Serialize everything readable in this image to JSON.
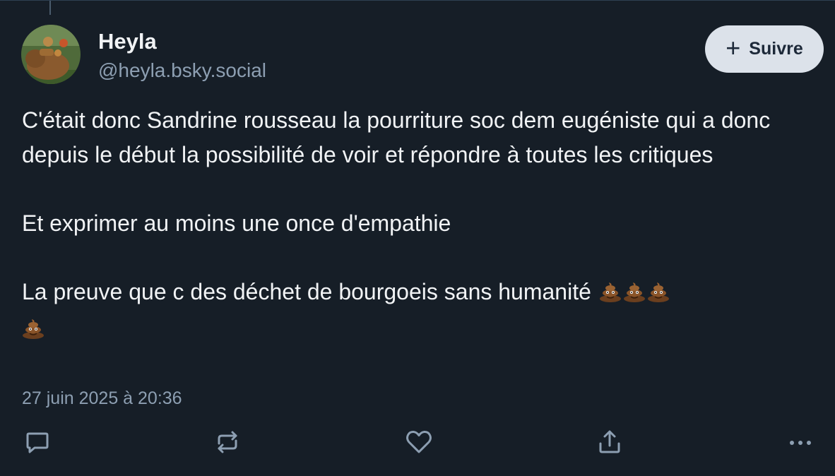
{
  "author": {
    "display_name": "Heyla",
    "handle": "@heyla.bsky.social"
  },
  "follow": {
    "icon": "plus-icon",
    "label": "Suivre"
  },
  "post": {
    "line1": "C'était donc Sandrine rousseau la pourriture soc dem eugéniste qui a donc depuis le début la possibilité de voir et répondre à toutes les critiques",
    "line2": "Et exprimer au moins une once d'empathie",
    "line3": "La preuve que c des déchet de bourgoeis sans humanité",
    "emoji": "pile-of-poo",
    "emoji_count": 4,
    "timestamp": "27 juin 2025 à 20:36"
  },
  "actions": [
    "reply-icon",
    "repost-icon",
    "like-icon",
    "share-icon",
    "more-icon"
  ],
  "colors": {
    "background": "#161e27",
    "text": "#f1f3f5",
    "muted": "#8d9fb2",
    "button_bg": "#dce2ea",
    "button_text": "#1d2939"
  }
}
